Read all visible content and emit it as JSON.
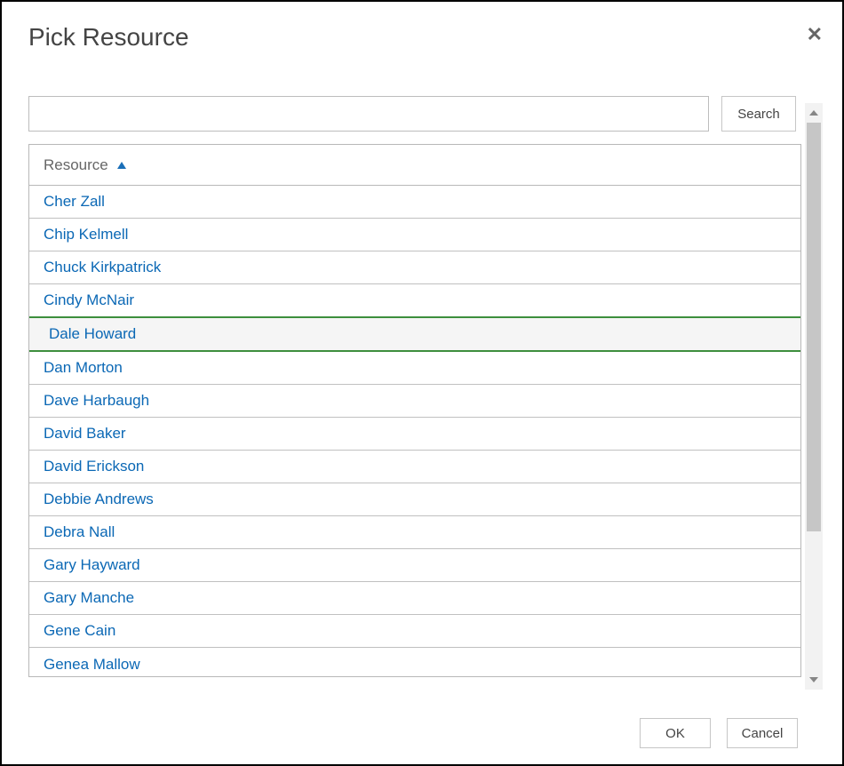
{
  "dialog": {
    "title": "Pick Resource"
  },
  "search": {
    "value": "",
    "placeholder": "",
    "button_label": "Search"
  },
  "table": {
    "column_header": "Resource",
    "sort": "asc",
    "selected_index": 4,
    "rows": [
      {
        "name": "Cher Zall"
      },
      {
        "name": "Chip Kelmell"
      },
      {
        "name": "Chuck Kirkpatrick"
      },
      {
        "name": "Cindy McNair"
      },
      {
        "name": "Dale Howard"
      },
      {
        "name": "Dan Morton"
      },
      {
        "name": "Dave Harbaugh"
      },
      {
        "name": "David Baker"
      },
      {
        "name": "David Erickson"
      },
      {
        "name": "Debbie Andrews"
      },
      {
        "name": "Debra Nall"
      },
      {
        "name": "Gary Hayward"
      },
      {
        "name": "Gary Manche"
      },
      {
        "name": "Gene Cain"
      },
      {
        "name": "Genea Mallow"
      }
    ]
  },
  "footer": {
    "ok_label": "OK",
    "cancel_label": "Cancel"
  }
}
